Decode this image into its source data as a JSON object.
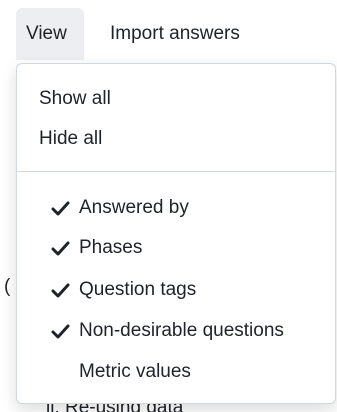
{
  "menubar": {
    "view_label": "View",
    "import_label": "Import answers"
  },
  "dropdown": {
    "actions": [
      {
        "label": "Show all"
      },
      {
        "label": "Hide all"
      }
    ],
    "toggles": [
      {
        "label": "Answered by",
        "checked": true
      },
      {
        "label": "Phases",
        "checked": true
      },
      {
        "label": "Question tags",
        "checked": true
      },
      {
        "label": "Non-desirable questions",
        "checked": true
      },
      {
        "label": "Metric values",
        "checked": false
      }
    ],
    "check_icon": "checkmark-icon"
  },
  "background": {
    "underlying_text": "ii. Re-using data"
  }
}
